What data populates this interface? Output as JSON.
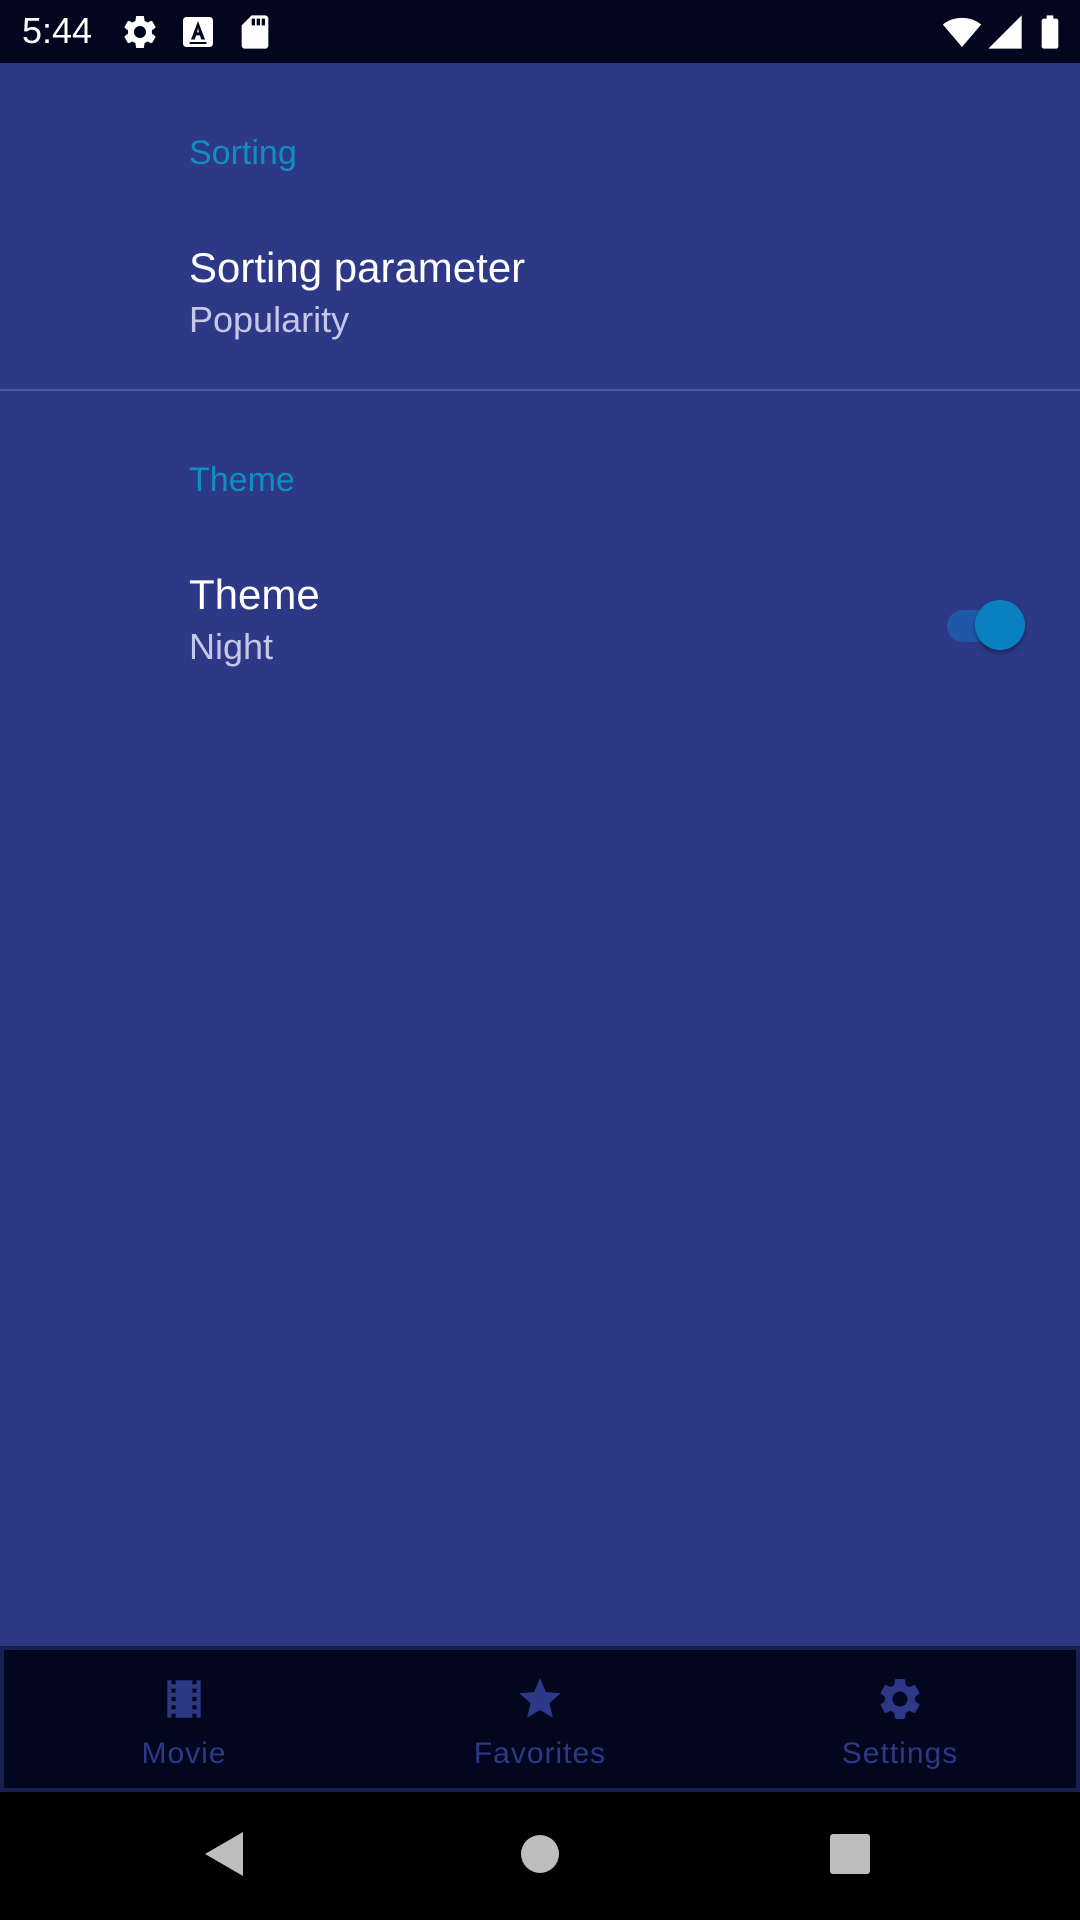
{
  "status_bar": {
    "time": "5:44",
    "left_icons": [
      "settings-gear-icon",
      "keyboard-a-icon",
      "sd-card-icon"
    ],
    "right_icons": [
      "wifi-icon",
      "cell-signal-icon",
      "battery-icon"
    ]
  },
  "settings": {
    "sorting_category": "Sorting",
    "sorting_parameter": {
      "title": "Sorting parameter",
      "summary": "Popularity"
    },
    "theme_category": "Theme",
    "theme": {
      "title": "Theme",
      "summary": "Night",
      "switch_on": true
    }
  },
  "bottom_nav": {
    "items": [
      {
        "label": "Movie",
        "icon": "movie-film-icon"
      },
      {
        "label": "Favorites",
        "icon": "star-icon"
      },
      {
        "label": "Settings",
        "icon": "settings-gear-icon"
      }
    ]
  },
  "system_nav": {
    "buttons": [
      "back-icon",
      "home-icon",
      "recents-icon"
    ]
  },
  "colors": {
    "background": "#2d3986",
    "accent": "#0f8fc0",
    "status_bar": "#02061e",
    "bottom_nav_bg": "#02061e",
    "nav_icon": "#2d3986"
  }
}
